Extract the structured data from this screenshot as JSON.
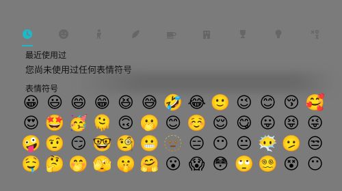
{
  "tabs": [
    {
      "icon": "clock-icon",
      "name": "tab-recent",
      "active": true
    },
    {
      "icon": "smiley-icon",
      "name": "tab-smileys",
      "active": false
    },
    {
      "icon": "person-icon",
      "name": "tab-people",
      "active": false
    },
    {
      "icon": "leaf-icon",
      "name": "tab-nature",
      "active": false
    },
    {
      "icon": "coffee-icon",
      "name": "tab-food",
      "active": false
    },
    {
      "icon": "building-icon",
      "name": "tab-places",
      "active": false
    },
    {
      "icon": "trophy-icon",
      "name": "tab-activities",
      "active": false
    },
    {
      "icon": "lightbulb-icon",
      "name": "tab-objects",
      "active": false
    },
    {
      "icon": "symbols-icon",
      "name": "tab-symbols",
      "active": false
    }
  ],
  "recent": {
    "title": "最近使用过",
    "empty_message": "您尚未使用过任何表情符号"
  },
  "emoji_section": {
    "title": "表情符号",
    "emojis": [
      "😀",
      "😃",
      "😄",
      "😁",
      "😆",
      "😅",
      "🤣",
      "😂",
      "🙂",
      "😉",
      "😊",
      "😚",
      "🥰",
      "😍",
      "🤩",
      "🥳",
      "🫠",
      "🙃",
      "🫢",
      "😊",
      "☺️",
      "😌",
      "😋",
      "😛",
      "😝",
      "😜",
      "🤪",
      "🤨",
      "😏",
      "🤓",
      "🧐",
      "😬",
      "🫥",
      "😑",
      "😶",
      "😐",
      "😶‍🌫️",
      "🫤",
      "😒",
      "🤤",
      "🤔",
      "🤭",
      "🫣",
      "🤫",
      "🤗",
      "😮",
      "😱",
      "😳",
      "🙄",
      "😵‍💫",
      "😵",
      "😶"
    ]
  }
}
